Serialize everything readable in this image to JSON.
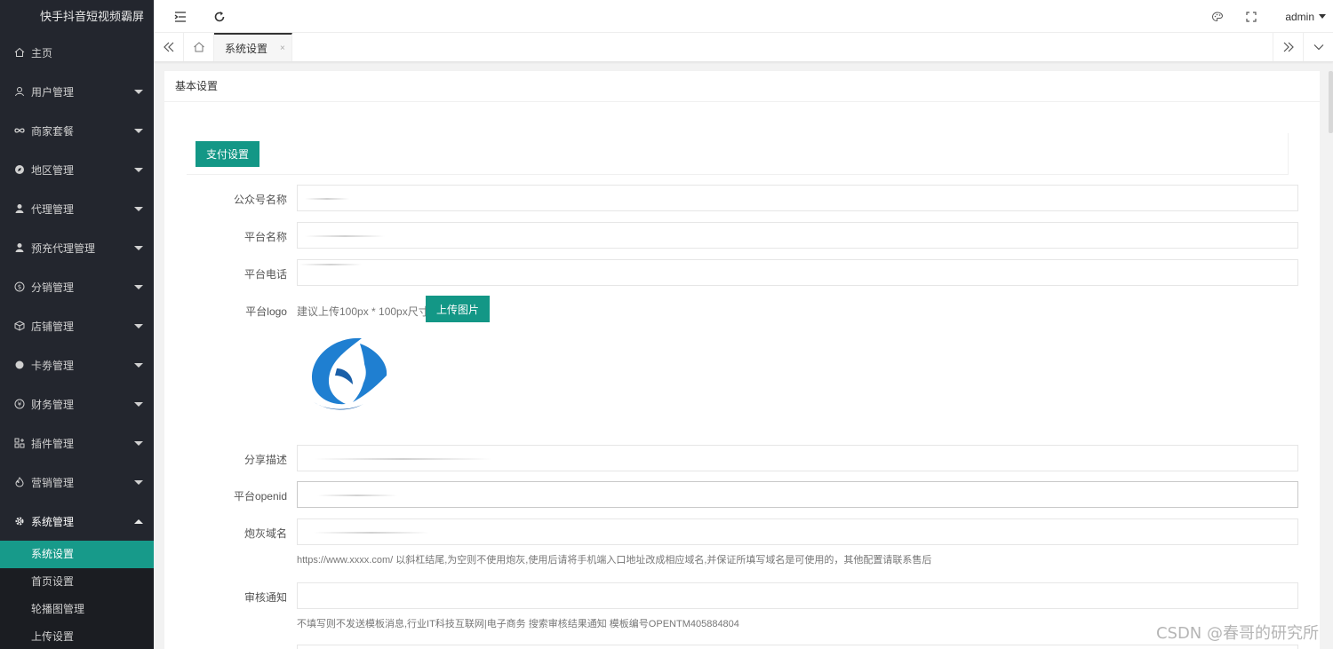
{
  "sidebar": {
    "title": "快手抖音短视频霸屏",
    "items": [
      {
        "label": "主页",
        "icon": "home-icon",
        "caret": false
      },
      {
        "label": "用户管理",
        "icon": "user-icon",
        "caret": true
      },
      {
        "label": "商家套餐",
        "icon": "infinity-icon",
        "caret": true
      },
      {
        "label": "地区管理",
        "icon": "compass-icon",
        "caret": true
      },
      {
        "label": "代理管理",
        "icon": "person-icon",
        "caret": true
      },
      {
        "label": "预充代理管理",
        "icon": "person-icon",
        "caret": true
      },
      {
        "label": "分销管理",
        "icon": "dollar-circle-icon",
        "caret": true
      },
      {
        "label": "店铺管理",
        "icon": "cube-icon",
        "caret": true
      },
      {
        "label": "卡劵管理",
        "icon": "dot-icon",
        "caret": true
      },
      {
        "label": "财务管理",
        "icon": "yen-circle-icon",
        "caret": true
      },
      {
        "label": "插件管理",
        "icon": "plugin-icon",
        "caret": true
      },
      {
        "label": "营销管理",
        "icon": "fire-icon",
        "caret": true
      },
      {
        "label": "系统管理",
        "icon": "gear-icon",
        "caret": true
      }
    ],
    "submenu": [
      "系统设置",
      "首页设置",
      "轮播图管理",
      "上传设置"
    ]
  },
  "header": {
    "user": "admin"
  },
  "tabs": {
    "active_label": "系统设置",
    "close_symbol": "×"
  },
  "panel": {
    "title": "基本设置",
    "pay_button": "支付设置",
    "fields": {
      "gzh_name": "公众号名称",
      "platform_name": "平台名称",
      "platform_phone": "平台电话",
      "platform_logo": "平台logo",
      "share_desc": "分享描述",
      "platform_openid": "平台openid",
      "cannon_domain": "炮灰域名",
      "audit_notice": "审核通知"
    },
    "logo_hint": "建议上传100px * 100px尺寸",
    "upload_button": "上传图片",
    "domain_hint": "https://www.xxxx.com/ 以斜杠结尾,为空则不使用炮灰,使用后请将手机端入口地址改成相应域名,并保证所填写域名是可使用的，其他配置请联系售后",
    "audit_hint": "不填写则不发送模板消息,行业IT科技互联网|电子商务 搜索审核结果通知 模板编号OPENTM405884804"
  },
  "watermark": "CSDN @春哥的研究所",
  "colors": {
    "sidebar_bg": "#23262e",
    "accent": "#139786",
    "active_sub": "#179a8a"
  }
}
